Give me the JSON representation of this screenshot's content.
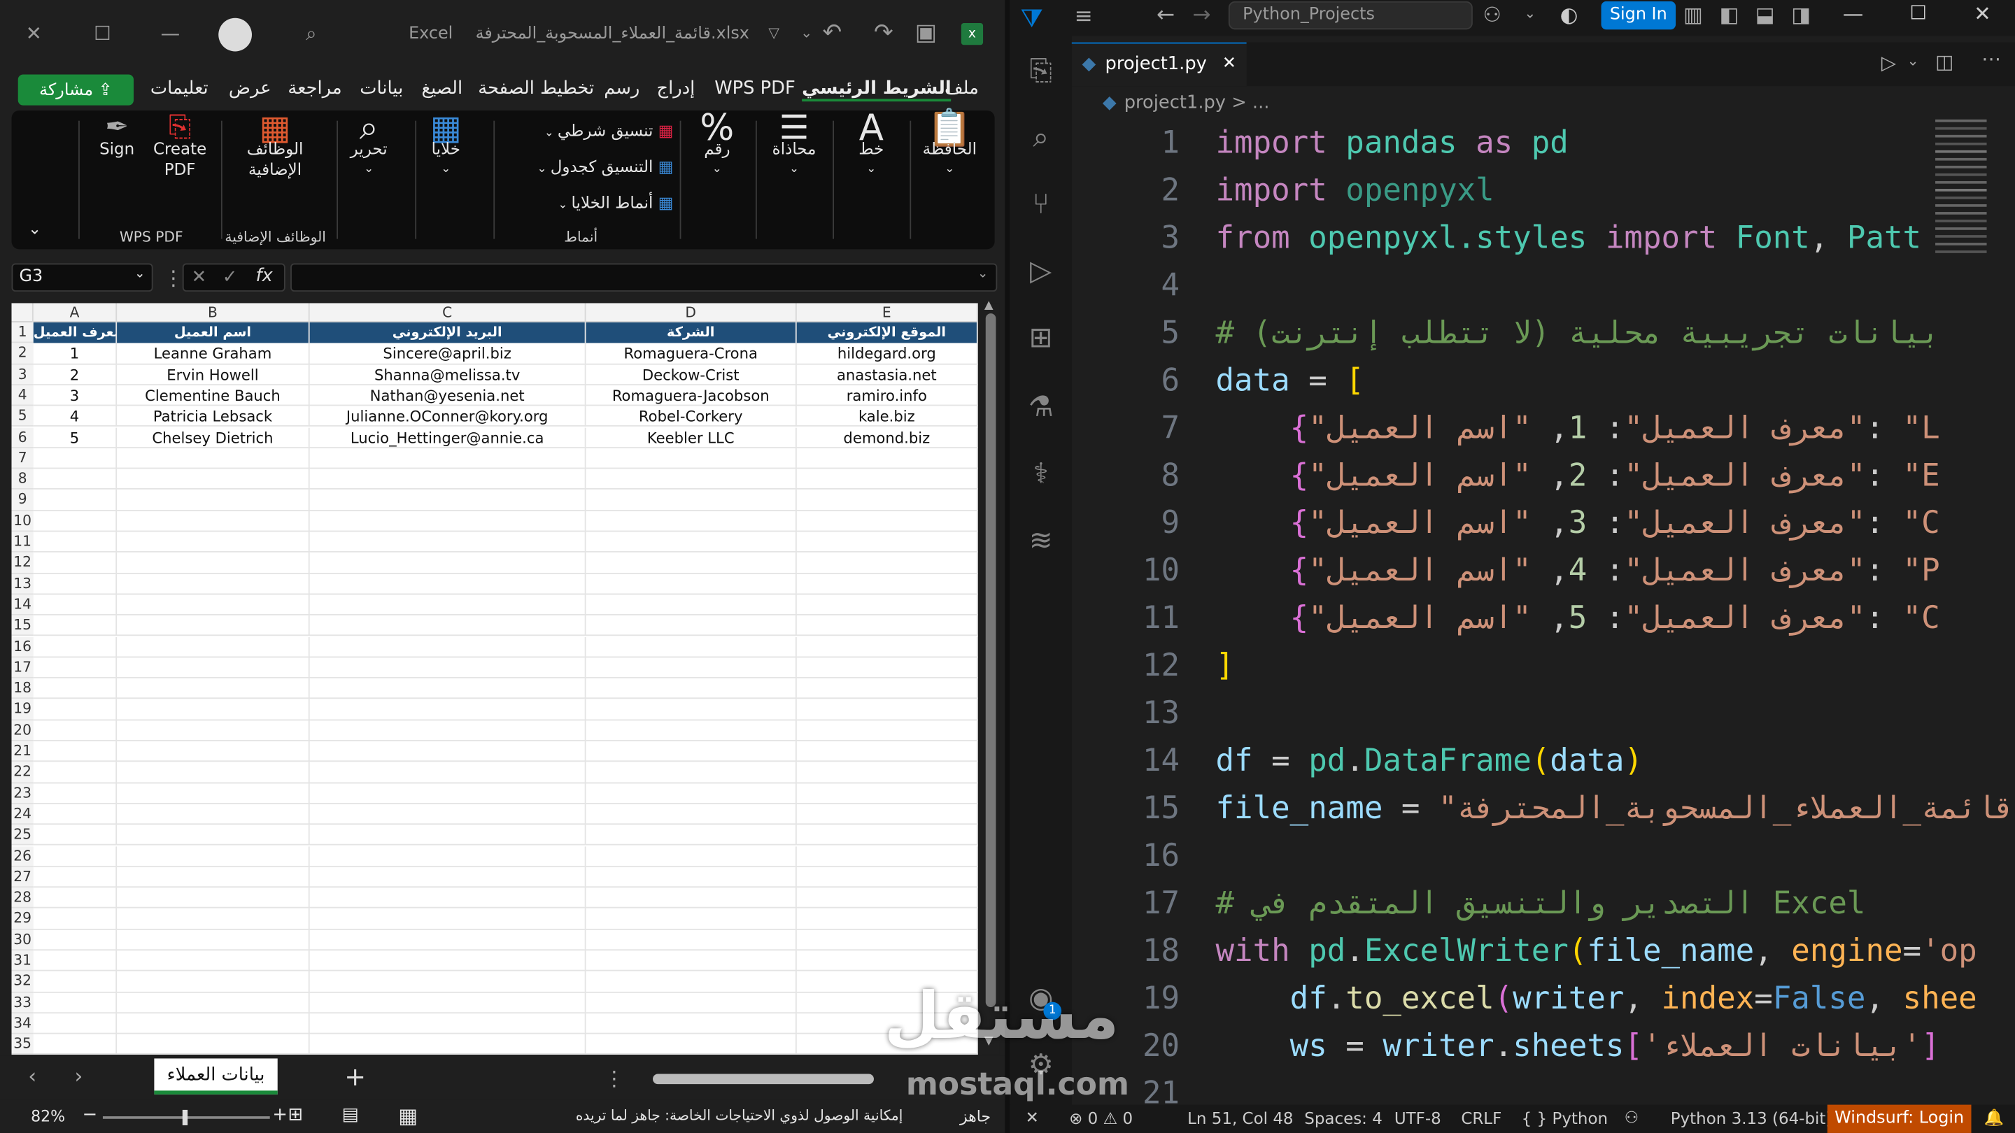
{
  "excel": {
    "window_title": "قائمة_العملاء_المسحوبة_المحترفة.xlsx",
    "app_name": "Excel",
    "tabs": [
      "ملف",
      "الشريط الرئيسي",
      "WPS PDF",
      "إدراج",
      "رسم",
      "تخطيط الصفحة",
      "الصيغ",
      "بيانات",
      "مراجعة",
      "عرض",
      "تعليمات"
    ],
    "share_label": "مشاركة",
    "ribbon": {
      "clipboard": "الحافظة",
      "font": "خط",
      "align": "محاذاة",
      "number": "رقم",
      "cond": "تنسيق شرطي",
      "table": "التنسيق كجدول",
      "styles": "أنماط الخلايا",
      "styles_group": "أنماط",
      "cells": "خلايا",
      "edit": "تحرير",
      "addins": "الوظائف الإضافية",
      "addins_group": "الوظائف الإضافية",
      "create_pdf": "Create PDF",
      "sign": "Sign",
      "wps_group": "WPS PDF"
    },
    "name_box": "G3",
    "columns": [
      "A",
      "B",
      "C",
      "D",
      "E"
    ],
    "headers": [
      "معرف العميل",
      "اسم العميل",
      "البريد الإلكتروني",
      "الشركة",
      "الموقع الإلكتروني"
    ],
    "rows": [
      [
        "1",
        "Leanne Graham",
        "Sincere@april.biz",
        "Romaguera-Crona",
        "hildegard.org"
      ],
      [
        "2",
        "Ervin Howell",
        "Shanna@melissa.tv",
        "Deckow-Crist",
        "anastasia.net"
      ],
      [
        "3",
        "Clementine Bauch",
        "Nathan@yesenia.net",
        "Romaguera-Jacobson",
        "ramiro.info"
      ],
      [
        "4",
        "Patricia Lebsack",
        "Julianne.OConner@kory.org",
        "Robel-Corkery",
        "kale.biz"
      ],
      [
        "5",
        "Chelsey Dietrich",
        "Lucio_Hettinger@annie.ca",
        "Keebler LLC",
        "demond.biz"
      ]
    ],
    "row_count": 35,
    "sheet_tab": "بيانات العملاء",
    "status": {
      "ready": "جاهز",
      "accessibility": "إمكانية الوصول لذوي الاحتياجات الخاصة: جاهز لما تريده",
      "zoom": "82%"
    }
  },
  "vscode": {
    "search": "Python_Projects",
    "signin": "Sign In",
    "file_tab": "project1.py",
    "breadcrumb": "project1.py > ...",
    "lines": [
      "1",
      "2",
      "3",
      "4",
      "5",
      "6",
      "7",
      "8",
      "9",
      "10",
      "11",
      "12",
      "13",
      "14",
      "15",
      "16",
      "17",
      "18",
      "19",
      "20",
      "21"
    ],
    "status": {
      "errors": "0",
      "warnings": "0",
      "position": "Ln 51, Col 48",
      "spaces": "Spaces: 4",
      "encoding": "UTF-8",
      "eol": "CRLF",
      "lang": "Python",
      "interpreter": "Python 3.13 (64-bit)",
      "windsurf": "Windsurf: Login",
      "badge": "1"
    }
  },
  "watermark": {
    "text": "مستقل",
    "sub": "mostaql.com"
  },
  "colors": {
    "header_fill": "#1f4e79",
    "share": "#1a8a3a",
    "accent": "#0078d4",
    "windsurf": "#c04a00"
  }
}
